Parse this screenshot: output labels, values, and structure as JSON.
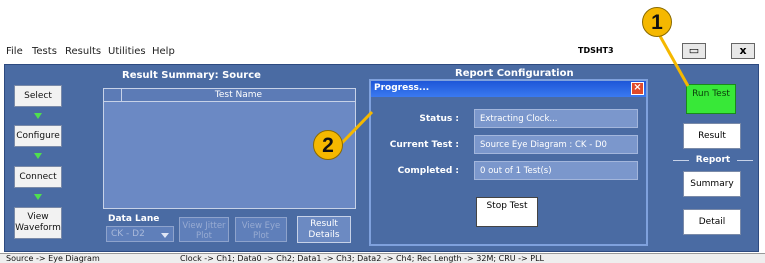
{
  "menu": {
    "items": [
      "File",
      "Tests",
      "Results",
      "Utilities",
      "Help"
    ],
    "app_id": "TDSHT3"
  },
  "window_controls": {
    "minimize": "▭",
    "close": "x"
  },
  "nav": {
    "select": "Select",
    "configure": "Configure",
    "connect": "Connect",
    "view_waveform": "View Waveform"
  },
  "result_summary": {
    "title": "Result Summary: Source",
    "column_test_name": "Test Name",
    "data_lane_label": "Data Lane",
    "data_lane_value": "CK - D2",
    "view_jitter_plot": "View Jitter Plot",
    "view_eye_plot": "View Eye Plot",
    "result_details": "Result Details"
  },
  "report_config": {
    "title": "Report Configuration",
    "run_test": "Run Test",
    "result": "Result",
    "report_header": "Report",
    "summary": "Summary",
    "detail": "Detail"
  },
  "progress_dialog": {
    "title": "Progress...",
    "status_label": "Status :",
    "status_value": "Extracting Clock...",
    "current_test_label": "Current Test :",
    "current_test_value": "Source Eye Diagram : CK - D0",
    "completed_label": "Completed :",
    "completed_value": "0 out of 1 Test(s)",
    "stop_test": "Stop Test"
  },
  "status_bar": {
    "left": "Source -> Eye Diagram",
    "right": "Clock -> Ch1; Data0 -> Ch2; Data1 -> Ch3; Data2 -> Ch4; Rec Length -> 32M; CRU -> PLL"
  },
  "callouts": {
    "one": "1",
    "two": "2"
  },
  "colors": {
    "panel_bg": "#4a6ba3",
    "run_button": "#38e838",
    "callout_fill": "#f5b800",
    "dialog_title": "#1e56d8"
  }
}
